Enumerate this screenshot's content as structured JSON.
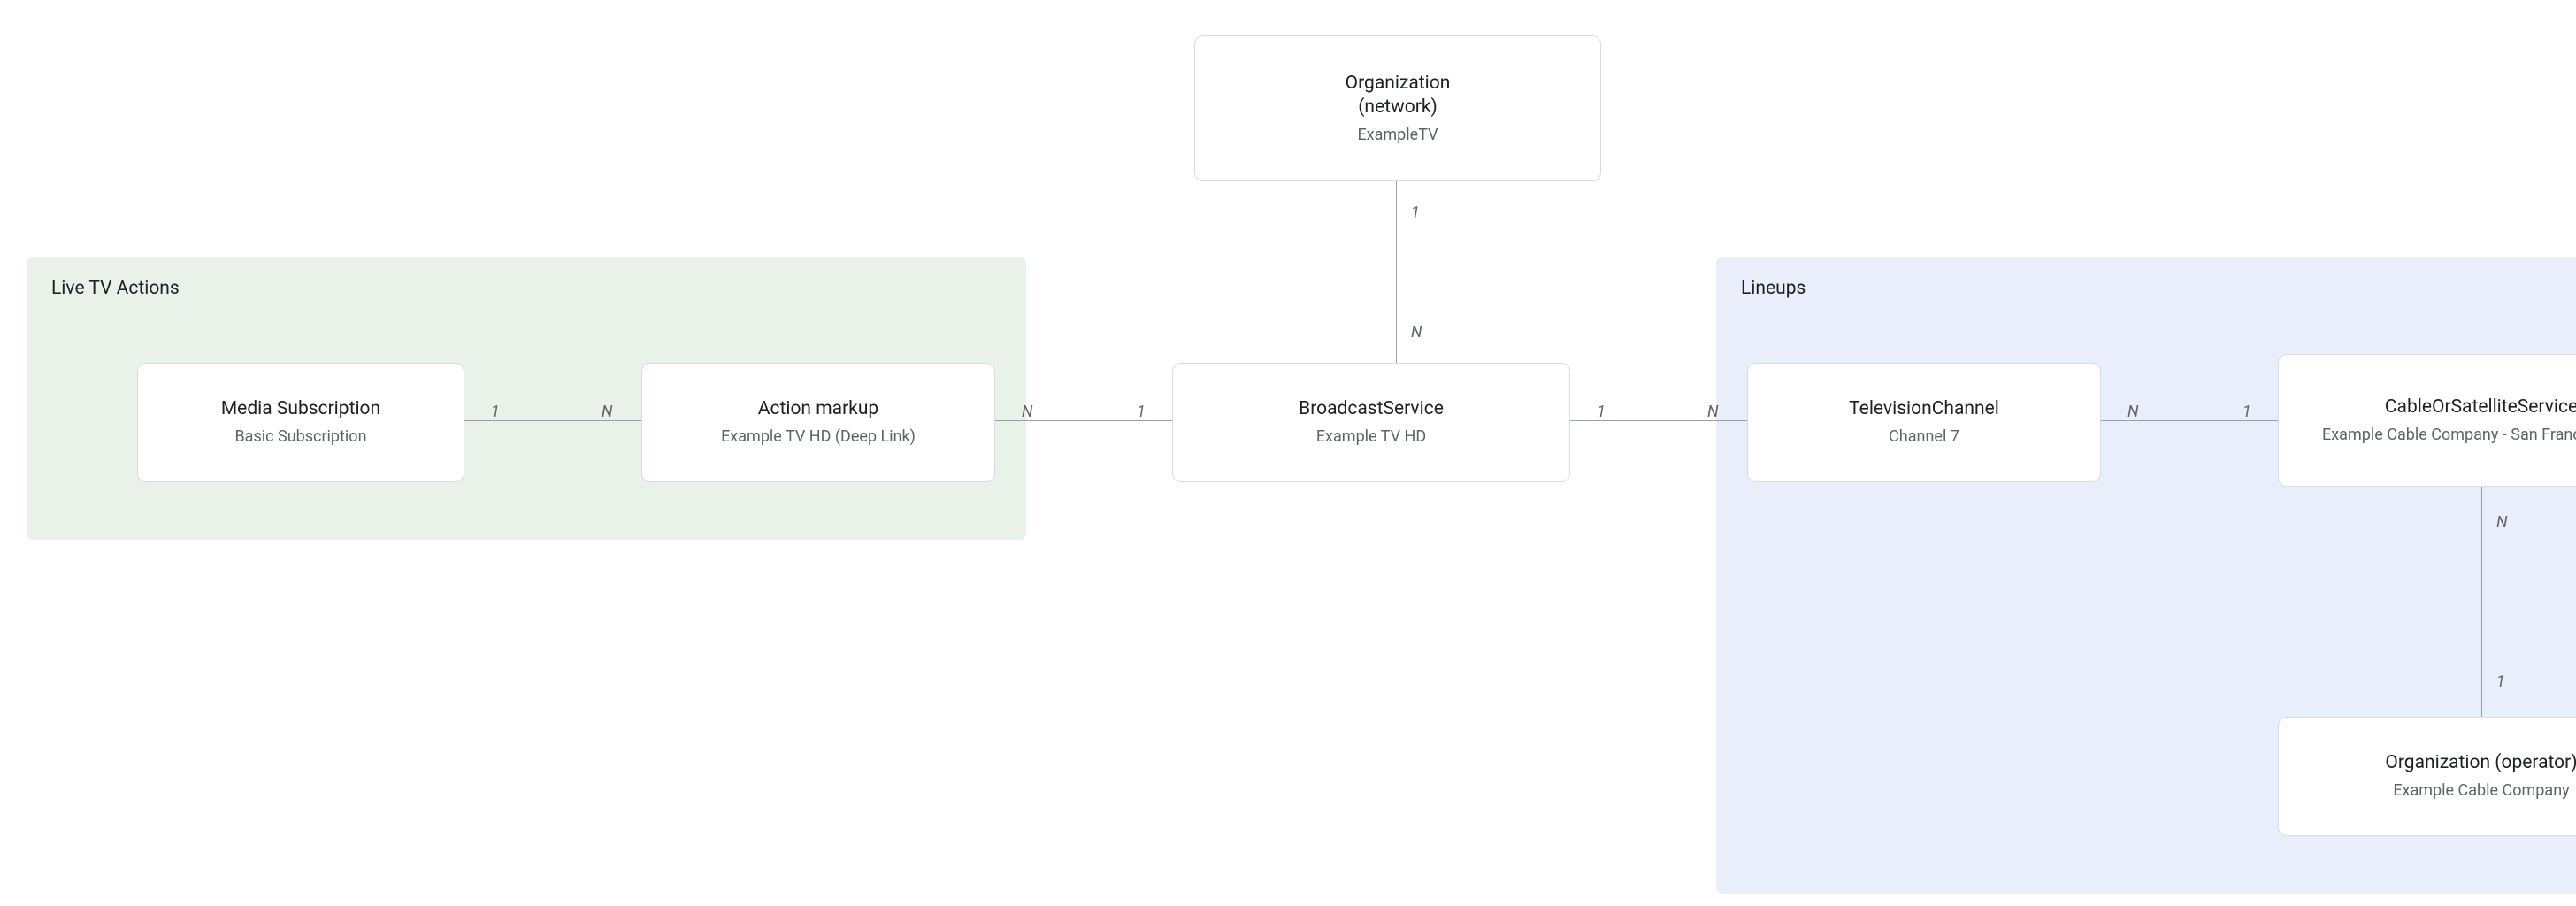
{
  "groups": {
    "live": {
      "label": "Live TV Actions"
    },
    "lineups": {
      "label": "Lineups"
    }
  },
  "nodes": {
    "org_network": {
      "title": "Organization\n(network)",
      "sub": "ExampleTV"
    },
    "media_sub": {
      "title": "Media Subscription",
      "sub": "Basic Subscription"
    },
    "action": {
      "title": "Action markup",
      "sub": "Example TV HD (Deep Link)"
    },
    "broadcast": {
      "title": "BroadcastService",
      "sub": "Example TV HD"
    },
    "tvchannel": {
      "title": "TelevisionChannel",
      "sub": "Channel 7"
    },
    "cable": {
      "title": "CableOrSatelliteService",
      "sub": "Example Cable Company - San Francisco Bay"
    },
    "org_op": {
      "title": "Organization (operator)",
      "sub": "Example Cable Company"
    }
  },
  "card": {
    "one": "1",
    "n": "N"
  }
}
